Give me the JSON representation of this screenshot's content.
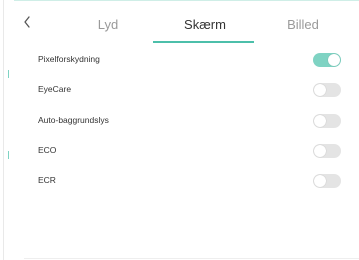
{
  "header": {
    "back_icon": "chevron-left-icon",
    "tabs": [
      {
        "label": "Lyd",
        "active": false
      },
      {
        "label": "Skærm",
        "active": true
      },
      {
        "label": "Billed",
        "active": false
      }
    ]
  },
  "settings": [
    {
      "label": "Pixelforskydning",
      "enabled": true
    },
    {
      "label": "EyeCare",
      "enabled": false
    },
    {
      "label": "Auto-baggrundslys",
      "enabled": false
    },
    {
      "label": "ECO",
      "enabled": false
    },
    {
      "label": "ECR",
      "enabled": false
    }
  ],
  "colors": {
    "accent": "#4cbfaa",
    "toggle_on": "#7fd3c3",
    "toggle_off": "#e4e4e4",
    "active_text": "#333333",
    "inactive_text": "#9a9a9a"
  }
}
